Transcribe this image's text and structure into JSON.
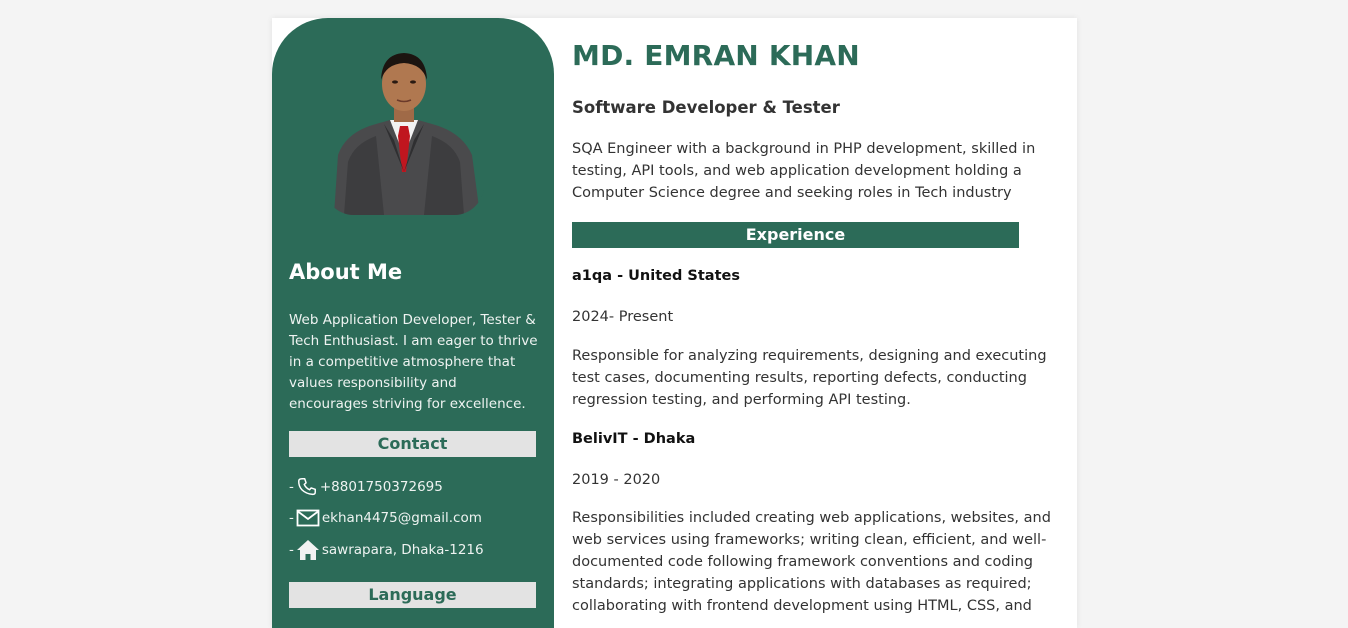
{
  "colors": {
    "accent": "#2c6b58",
    "heading_bg": "#e3e3e3",
    "page_bg": "#f4f4f4"
  },
  "profile": {
    "name": "MD. EMRAN KHAN",
    "role": "Software Developer & Tester",
    "summary": "SQA Engineer with a background in PHP development, skilled in testing, API tools, and web application development holding a Computer Science degree and seeking roles in Tech industry"
  },
  "sidebar": {
    "about_title": "About Me",
    "about_text": "Web Application Developer, Tester & Tech Enthusiast. I am eager to thrive in a competitive atmosphere that values responsibility and encourages striving for excellence.",
    "contact_heading": "Contact",
    "contacts": [
      {
        "dash": "-",
        "icon": "phone-icon",
        "text": "+8801750372695"
      },
      {
        "dash": "-",
        "icon": "mail-icon",
        "text": "ekhan4475@gmail.com"
      },
      {
        "dash": "-",
        "icon": "home-icon",
        "text": "sawrapara, Dhaka-1216"
      }
    ],
    "language_heading": "Language"
  },
  "experience": {
    "heading": "Experience",
    "jobs": [
      {
        "title": "a1qa - United States",
        "period": "2024- Present",
        "description": "Responsible for analyzing requirements, designing and executing test cases, documenting results, reporting defects, conducting regression testing, and performing API testing."
      },
      {
        "title": "BelivIT - Dhaka",
        "period": "2019 - 2020",
        "description": "Responsibilities included creating web applications, websites, and web services using frameworks; writing clean, efficient, and well-documented code following framework conventions and coding standards; integrating applications with databases as required; collaborating with frontend development using HTML, CSS, and"
      }
    ]
  }
}
